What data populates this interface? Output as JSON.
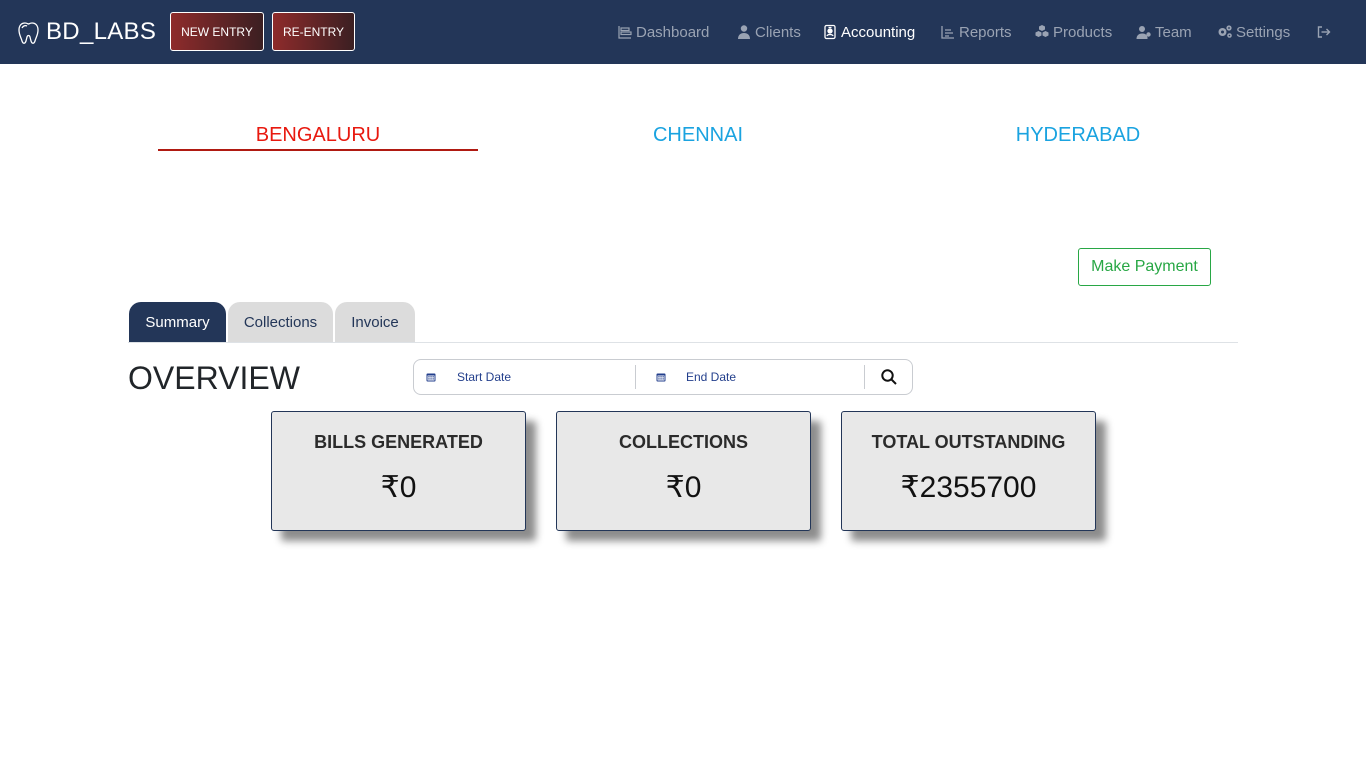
{
  "brand": {
    "name": "BD_LABS",
    "logo_icon": "tooth-icon"
  },
  "header_buttons": {
    "new_entry": "NEW ENTRY",
    "re_entry": "RE-ENTRY"
  },
  "nav": {
    "items": [
      {
        "label": "Dashboard",
        "icon": "dashboard-icon"
      },
      {
        "label": "Clients",
        "icon": "user-icon"
      },
      {
        "label": "Accounting",
        "icon": "id-badge-icon",
        "active": true
      },
      {
        "label": "Reports",
        "icon": "chart-icon"
      },
      {
        "label": "Products",
        "icon": "cubes-icon"
      },
      {
        "label": "Team",
        "icon": "users-icon"
      },
      {
        "label": "Settings",
        "icon": "gears-icon"
      }
    ],
    "logout_icon": "logout-icon"
  },
  "cities": [
    {
      "label": "BENGALURU",
      "active": true
    },
    {
      "label": "CHENNAI",
      "active": false
    },
    {
      "label": "HYDERABAD",
      "active": false
    }
  ],
  "make_payment_label": "Make Payment",
  "tabs": [
    {
      "label": "Summary",
      "active": true
    },
    {
      "label": "Collections",
      "active": false
    },
    {
      "label": "Invoice",
      "active": false
    }
  ],
  "overview_title": "OVERVIEW",
  "date_filter": {
    "start_placeholder": "Start Date",
    "end_placeholder": "End Date"
  },
  "cards": [
    {
      "title": "BILLS GENERATED",
      "value": "₹0"
    },
    {
      "title": "COLLECTIONS",
      "value": "₹0"
    },
    {
      "title": "TOTAL OUTSTANDING",
      "value": "₹2355700"
    }
  ],
  "colors": {
    "navbar": "#233658",
    "active_city": "#e8190f",
    "inactive_city": "#1aa3e0",
    "payment_green": "#28a745",
    "entry_button_gradient": [
      "#8e2b2b",
      "#3b1f22"
    ]
  }
}
